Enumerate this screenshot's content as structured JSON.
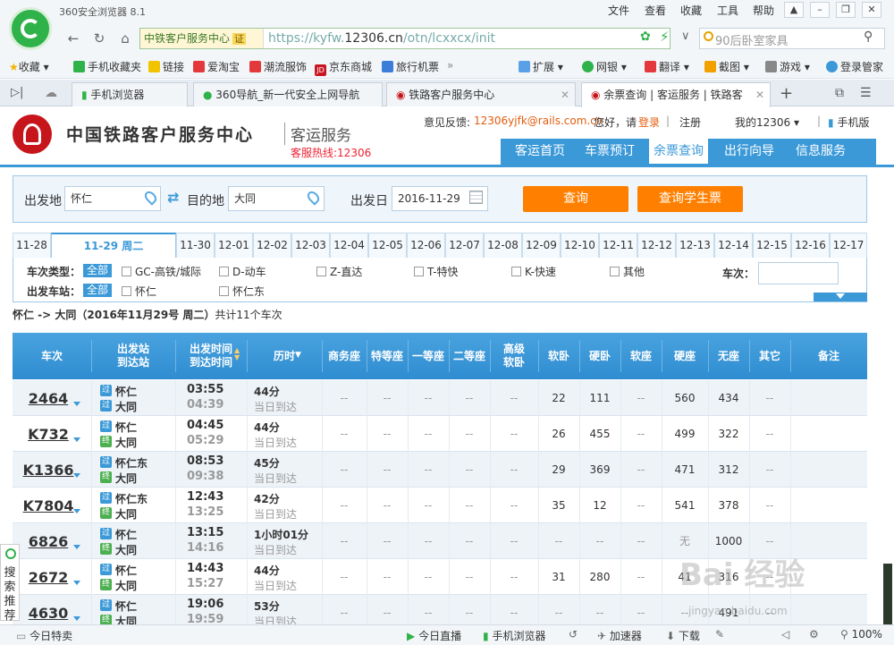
{
  "browser": {
    "app_title": "360安全浏览器 8.1",
    "menu": [
      "文件",
      "查看",
      "收藏",
      "工具",
      "帮助"
    ],
    "site_label": "中铁客户服务中心",
    "cert_label": "证",
    "url_prefix": "https://kyfw.",
    "url_domain": "12306.cn",
    "url_path": "/otn/lcxxcx/init",
    "search_placeholder": "90后卧室家具",
    "bookmarks": [
      "收藏",
      "手机收藏夹",
      "链接",
      "爱淘宝",
      "潮流服饰",
      "京东商城",
      "旅行机票",
      "扩展",
      "网银",
      "翻译",
      "截图",
      "游戏",
      "登录管家"
    ],
    "tabs": [
      "手机浏览器",
      "360导航_新一代安全上网导航",
      "铁路客户服务中心",
      "余票查询 | 客运服务 | 铁路客"
    ],
    "statusbar": {
      "left": "今日特卖",
      "live": "今日直播",
      "mobile": "手机浏览器",
      "speed": "加速器",
      "download": "下载",
      "zoom": "100%"
    },
    "sidetab": "搜索推荐"
  },
  "site": {
    "name": "中国铁路客户服务中心",
    "sub": "客运服务",
    "hotline": "客服热线:12306",
    "feedback_label": "意见反馈:",
    "feedback_email": "12306yjfk@rails.com.cn",
    "greeting": "您好，请",
    "login": "登录",
    "register": "注册",
    "my12306": "我的12306",
    "mobile": "手机版",
    "nav": [
      "客运首页",
      "车票预订",
      "余票查询",
      "出行向导",
      "信息服务"
    ]
  },
  "form": {
    "from_label": "出发地",
    "from_value": "怀仁",
    "to_label": "目的地",
    "to_value": "大同",
    "date_label": "出发日",
    "date_value": "2016-11-29",
    "query": "查询",
    "query_student": "查询学生票"
  },
  "dates": [
    "11-28",
    "11-29 周二",
    "12-01",
    "12-02",
    "12-03",
    "12-04",
    "12-05",
    "12-06",
    "12-07",
    "12-08",
    "12-09",
    "12-10",
    "12-11",
    "12-12",
    "12-13",
    "12-14",
    "12-15",
    "12-16",
    "12-17"
  ],
  "dates_fix": "11-30",
  "filters": {
    "type_label": "车次类型：",
    "all": "全部",
    "types": [
      "GC-高铁/城际",
      "D-动车",
      "Z-直达",
      "T-特快",
      "K-快速",
      "其他"
    ],
    "station_label": "出发车站：",
    "stations": [
      "怀仁",
      "怀仁东"
    ],
    "trainno_label": "车次："
  },
  "summary": {
    "route": "怀仁 -> 大同（2016年11月29号  周二）",
    "count": "共计11个车次"
  },
  "table": {
    "headers": [
      "车次",
      "出发站\n到达站",
      "出发时间\n到达时间",
      "历时",
      "商务座",
      "特等座",
      "一等座",
      "二等座",
      "高级\n软卧",
      "软卧",
      "硬卧",
      "软座",
      "硬座",
      "无座",
      "其它",
      "备注"
    ],
    "rows": [
      {
        "no": "2464",
        "b1": "过",
        "b2": "过",
        "s1": "怀仁",
        "s2": "大同",
        "dep": "03:55",
        "arr": "04:39",
        "dur": "44分",
        "note": "当日到达",
        "seats": [
          "--",
          "--",
          "--",
          "--",
          "--",
          "22",
          "111",
          "--",
          "560",
          "434",
          "--"
        ]
      },
      {
        "no": "K732",
        "b1": "过",
        "b2": "终",
        "s1": "怀仁",
        "s2": "大同",
        "dep": "04:45",
        "arr": "05:29",
        "dur": "44分",
        "note": "当日到达",
        "seats": [
          "--",
          "--",
          "--",
          "--",
          "--",
          "26",
          "455",
          "--",
          "499",
          "322",
          "--"
        ]
      },
      {
        "no": "K1366",
        "b1": "过",
        "b2": "终",
        "s1": "怀仁东",
        "s2": "大同",
        "dep": "08:53",
        "arr": "09:38",
        "dur": "45分",
        "note": "当日到达",
        "seats": [
          "--",
          "--",
          "--",
          "--",
          "--",
          "29",
          "369",
          "--",
          "471",
          "312",
          "--"
        ]
      },
      {
        "no": "K7804",
        "b1": "过",
        "b2": "终",
        "s1": "怀仁东",
        "s2": "大同",
        "dep": "12:43",
        "arr": "13:25",
        "dur": "42分",
        "note": "当日到达",
        "seats": [
          "--",
          "--",
          "--",
          "--",
          "--",
          "35",
          "12",
          "--",
          "541",
          "378",
          "--"
        ]
      },
      {
        "no": "6826",
        "b1": "过",
        "b2": "终",
        "s1": "怀仁",
        "s2": "大同",
        "dep": "13:15",
        "arr": "14:16",
        "dur": "1小时01分",
        "note": "当日到达",
        "seats": [
          "--",
          "--",
          "--",
          "--",
          "--",
          "--",
          "--",
          "--",
          "无",
          "1000",
          "--"
        ]
      },
      {
        "no": "2672",
        "b1": "过",
        "b2": "终",
        "s1": "怀仁",
        "s2": "大同",
        "dep": "14:43",
        "arr": "15:27",
        "dur": "44分",
        "note": "当日到达",
        "seats": [
          "--",
          "--",
          "--",
          "--",
          "--",
          "31",
          "280",
          "--",
          "41",
          "316",
          "--"
        ]
      },
      {
        "no": "4630",
        "b1": "过",
        "b2": "终",
        "s1": "怀仁",
        "s2": "大同",
        "dep": "19:06",
        "arr": "19:59",
        "dur": "53分",
        "note": "当日到达",
        "seats": [
          "--",
          "--",
          "--",
          "--",
          "--",
          "--",
          "--",
          "--",
          "--",
          "491",
          "--"
        ]
      }
    ]
  },
  "watermark": {
    "brand": "Bai 经验",
    "url": "jingyan.baidu.com"
  },
  "colors": {
    "accent": "#3b99d8",
    "orange": "#ff8000",
    "brand_red": "#c6161c"
  }
}
